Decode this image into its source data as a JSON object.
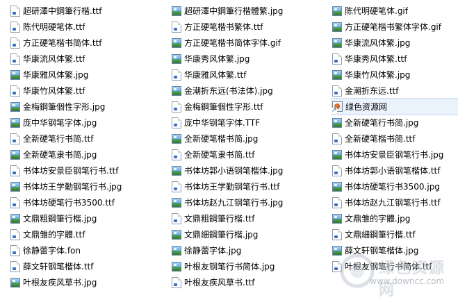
{
  "files": {
    "column_1": [
      {
        "name": "超研澤中鋼筆行楷.ttf",
        "icon": "font-file-icon"
      },
      {
        "name": "陈代明硬笔体.ttf",
        "icon": "font-file-icon"
      },
      {
        "name": "方正硬笔楷书简体.ttf",
        "icon": "font-file-icon"
      },
      {
        "name": "华康流风体繁.ttf",
        "icon": "font-file-icon"
      },
      {
        "name": "华康雅风体繁.jpg",
        "icon": "image-file-icon"
      },
      {
        "name": "华康竹风体繁.ttf",
        "icon": "font-file-icon"
      },
      {
        "name": "金梅鋼筆個性字形.jpg",
        "icon": "image-file-icon"
      },
      {
        "name": "庞中华钢笔字体.jpg",
        "icon": "image-file-icon"
      },
      {
        "name": "全新硬笔行书简.ttf",
        "icon": "font-file-icon"
      },
      {
        "name": "全新硬笔隶书简.jpg",
        "icon": "image-file-icon"
      },
      {
        "name": "书体坊安景臣钢笔行书.ttf",
        "icon": "font-file-icon"
      },
      {
        "name": "书体坊王学勤钢笔行书.jpg",
        "icon": "image-file-icon"
      },
      {
        "name": "书体坊硬笔行书3500.ttf",
        "icon": "font-file-icon"
      },
      {
        "name": "文鼎粗鋼筆行楷.jpg",
        "icon": "image-file-icon"
      },
      {
        "name": "文鼎雏的字體.ttf",
        "icon": "font-file-icon"
      },
      {
        "name": "徐静蕾字体.fon",
        "icon": "font-file-icon"
      },
      {
        "name": "薛文轩钢笔楷体.ttf",
        "icon": "font-file-icon"
      },
      {
        "name": "叶根友疾风草书.jpg",
        "icon": "image-file-icon"
      }
    ],
    "column_2": [
      {
        "name": "超研澤中鋼筆行楷體繁.jpg",
        "icon": "image-file-icon"
      },
      {
        "name": "方正硬笔楷书繁体.ttf",
        "icon": "font-file-icon"
      },
      {
        "name": "方正硬笔楷书简体字体.gif",
        "icon": "image-file-icon"
      },
      {
        "name": "华康秀风体繁.jpg",
        "icon": "image-file-icon"
      },
      {
        "name": "华康雅风体繁.ttf",
        "icon": "font-file-icon"
      },
      {
        "name": "金潮折东远(书法体).jpg",
        "icon": "image-file-icon"
      },
      {
        "name": "金梅鋼筆個性字形.ttf",
        "icon": "font-file-icon"
      },
      {
        "name": "庞中华钢笔字体.TTF",
        "icon": "font-file-icon"
      },
      {
        "name": "全新硬笔楷书简.jpg",
        "icon": "image-file-icon"
      },
      {
        "name": "全新硬笔隶书简.ttf",
        "icon": "font-file-icon"
      },
      {
        "name": "书体坊郭小语钢笔楷体.jpg",
        "icon": "image-file-icon"
      },
      {
        "name": "书体坊王学勤钢笔行书.ttf",
        "icon": "font-file-icon"
      },
      {
        "name": "书体坊赵九江钢笔行书.jpg",
        "icon": "image-file-icon"
      },
      {
        "name": "文鼎粗鋼筆行楷.ttf",
        "icon": "font-file-icon"
      },
      {
        "name": "文鼎細鋼筆行楷.jpg",
        "icon": "image-file-icon"
      },
      {
        "name": "徐静蕾字体.jpg",
        "icon": "image-file-icon"
      },
      {
        "name": "叶根友钢笔行书简体.jpg",
        "icon": "image-file-icon"
      },
      {
        "name": "叶根友疾风草书.ttf",
        "icon": "font-file-icon"
      }
    ],
    "column_3": [
      {
        "name": "陈代明硬笔体.gif",
        "icon": "image-file-icon"
      },
      {
        "name": "方正硬笔楷书繁体字体.gif",
        "icon": "image-file-icon"
      },
      {
        "name": "华康流风体繁.jpg",
        "icon": "image-file-icon"
      },
      {
        "name": "华康秀风体繁.ttf",
        "icon": "font-file-icon"
      },
      {
        "name": "华康竹风体繁.jpg",
        "icon": "image-file-icon"
      },
      {
        "name": "金潮折东远.ttf",
        "icon": "font-file-icon"
      },
      {
        "name": "绿色资源网",
        "icon": "url-shortcut-icon"
      },
      {
        "name": "全新硬笔行书简.jpg",
        "icon": "image-file-icon"
      },
      {
        "name": "全新硬笔楷书简.ttf",
        "icon": "font-file-icon"
      },
      {
        "name": "书体坊安景臣钢笔行书.jpg",
        "icon": "image-file-icon"
      },
      {
        "name": "书体坊郭小语钢笔楷体.ttf",
        "icon": "font-file-icon"
      },
      {
        "name": "书体坊硬笔行书3500.jpg",
        "icon": "image-file-icon"
      },
      {
        "name": "书体坊赵九江钢笔行书.ttf",
        "icon": "font-file-icon"
      },
      {
        "name": "文鼎雏的字體.jpg",
        "icon": "image-file-icon"
      },
      {
        "name": "文鼎細鋼筆行楷.ttf",
        "icon": "font-file-icon"
      },
      {
        "name": "薛文轩钢笔楷体.jpg",
        "icon": "image-file-icon"
      },
      {
        "name": "叶根友钢笔行书简体.ttf",
        "icon": "font-file-icon"
      }
    ]
  },
  "watermark": {
    "title": "绿色资源网",
    "url": "www.downcc.com"
  }
}
